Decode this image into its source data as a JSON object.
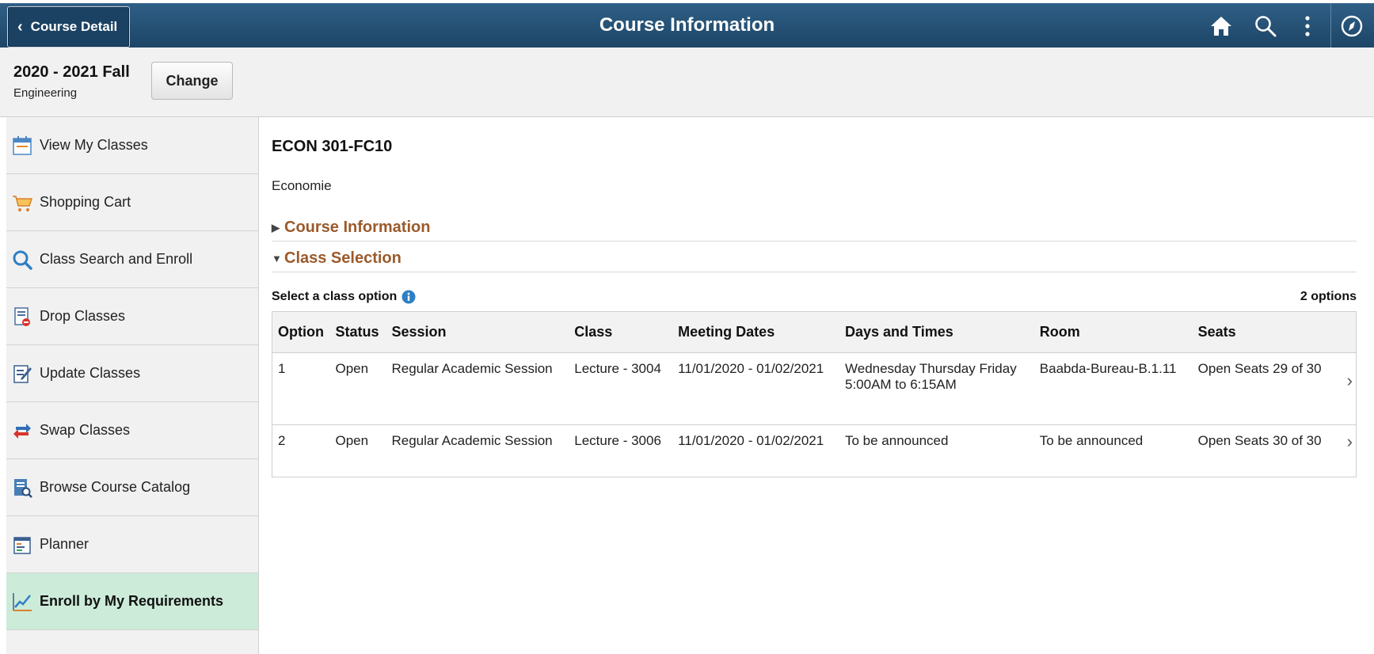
{
  "header": {
    "back_label": "Course Detail",
    "title": "Course Information",
    "icons": [
      "home-icon",
      "search-icon",
      "more-vertical-icon",
      "navigator-compass-icon"
    ]
  },
  "term": {
    "title": "2020 - 2021 Fall",
    "career": "Engineering",
    "change_label": "Change"
  },
  "sidebar": {
    "items": [
      {
        "label": "View My Classes",
        "icon": "calendar-icon"
      },
      {
        "label": "Shopping Cart",
        "icon": "cart-icon"
      },
      {
        "label": "Class Search and Enroll",
        "icon": "search-icon"
      },
      {
        "label": "Drop Classes",
        "icon": "drop-list-icon"
      },
      {
        "label": "Update Classes",
        "icon": "edit-document-icon"
      },
      {
        "label": "Swap Classes",
        "icon": "swap-arrows-icon"
      },
      {
        "label": "Browse Course Catalog",
        "icon": "catalog-search-icon"
      },
      {
        "label": "Planner",
        "icon": "planner-icon"
      },
      {
        "label": "Enroll by My Requirements",
        "icon": "chart-trend-icon",
        "active": true
      }
    ]
  },
  "course": {
    "code": "ECON 301-FC10",
    "name": "Economie"
  },
  "sections": {
    "course_info": "Course Information",
    "class_selection": "Class Selection"
  },
  "selection": {
    "label": "Select a class option",
    "count": "2 options"
  },
  "table": {
    "headers": {
      "option": "Option",
      "status": "Status",
      "session": "Session",
      "class": "Class",
      "dates": "Meeting Dates",
      "days": "Days and Times",
      "room": "Room",
      "seats": "Seats"
    },
    "rows": [
      {
        "option": "1",
        "status": "Open",
        "session": "Regular Academic Session",
        "class": "Lecture - 3004",
        "dates": "11/01/2020 - 01/02/2021",
        "days_line1": "Wednesday Thursday Friday",
        "days_line2": "5:00AM to 6:15AM",
        "room": "Baabda-Bureau-B.1.11",
        "seats": "Open Seats 29 of 30"
      },
      {
        "option": "2",
        "status": "Open",
        "session": "Regular Academic Session",
        "class": "Lecture - 3006",
        "dates": "11/01/2020 - 01/02/2021",
        "days_line1": "To be announced",
        "days_line2": "",
        "room": "To be announced",
        "seats": "Open Seats 30 of 30"
      }
    ]
  }
}
